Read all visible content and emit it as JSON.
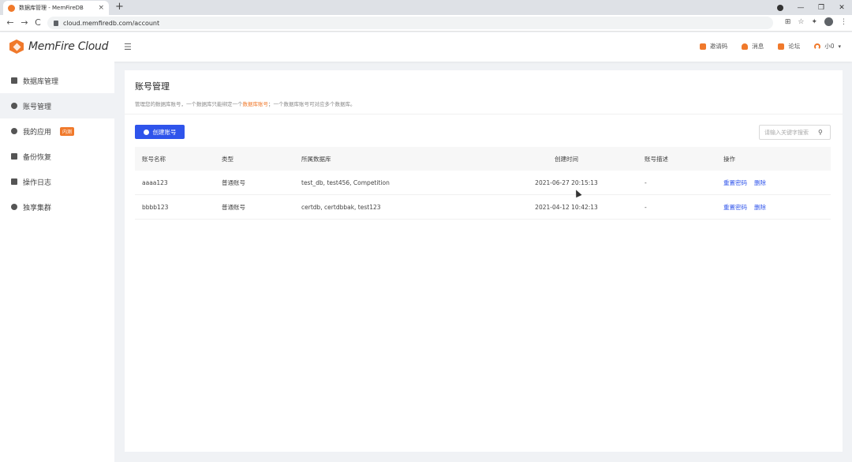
{
  "browser": {
    "tab_title": "数据库管理 - MemFireDB",
    "tab_close": "×",
    "new_tab": "+",
    "url": "cloud.memfiredb.com/account",
    "nav": {
      "back": "←",
      "forward": "→",
      "reload": "C"
    },
    "window": {
      "minimize": "—",
      "restore": "❐",
      "close": "✕"
    },
    "ext": {
      "translate": "⊞",
      "star": "☆",
      "puzzle": "✦",
      "menu": "⋮"
    }
  },
  "header": {
    "brand": "MemFire Cloud",
    "collapse": "☰",
    "items": [
      {
        "label": "邀请码",
        "icon": "gift-icon"
      },
      {
        "label": "消息",
        "icon": "bell-icon"
      },
      {
        "label": "论坛",
        "icon": "forum-icon"
      },
      {
        "label": "小0",
        "icon": "user-icon"
      }
    ],
    "caret": "▾"
  },
  "sidebar": {
    "items": [
      {
        "label": "数据库管理",
        "icon": "database-icon",
        "active": false
      },
      {
        "label": "账号管理",
        "icon": "users-icon",
        "active": true
      },
      {
        "label": "我的应用",
        "icon": "app-icon",
        "badge": "内测",
        "active": false
      },
      {
        "label": "备份恢复",
        "icon": "backup-icon",
        "active": false
      },
      {
        "label": "操作日志",
        "icon": "log-icon",
        "active": false
      },
      {
        "label": "独享集群",
        "icon": "cluster-icon",
        "active": false
      }
    ]
  },
  "main": {
    "title": "账号管理",
    "desc_parts": [
      "管理您的数据库账号，一个数据库只能绑定一个",
      "数据库账号",
      "；一个数据库账号可对应多个数据库。"
    ],
    "create_button": "创建账号",
    "search_placeholder": "请输入关键字搜索",
    "search_icon": "⚲",
    "columns": [
      "账号名称",
      "类型",
      "所属数据库",
      "创建时间",
      "账号描述",
      "操作"
    ],
    "rows": [
      {
        "name": "aaaa123",
        "type": "普通账号",
        "dbs": "test_db, test456, Competition",
        "created": "2021-06-27 20:15:13",
        "desc": "-",
        "actions": [
          "重置密码",
          "删除"
        ]
      },
      {
        "name": "bbbb123",
        "type": "普通账号",
        "dbs": "certdb, certdbbak, test123",
        "created": "2021-04-12 10:42:13",
        "desc": "-",
        "actions": [
          "重置密码",
          "删除"
        ]
      }
    ]
  },
  "colors": {
    "accent": "#2f54eb",
    "brand": "#f0792b"
  }
}
